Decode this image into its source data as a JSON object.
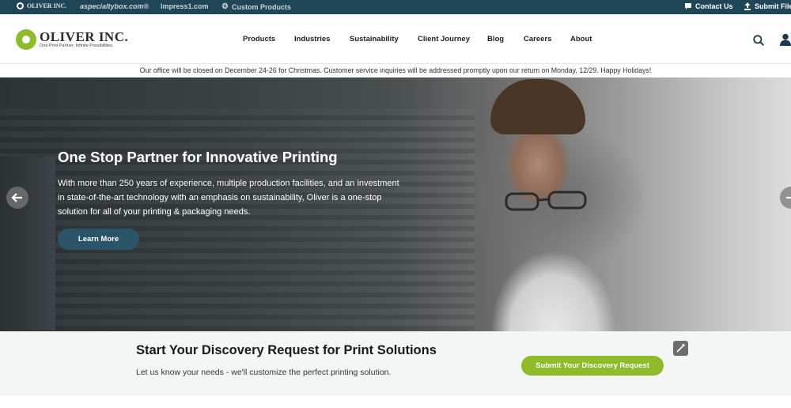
{
  "topbar": {
    "brands": [
      "OLIVER INC.",
      "aspecialtybox.com®",
      "Impress1.com",
      "Custom Products"
    ],
    "contact_label": "Contact Us",
    "submit_label": "Submit Files"
  },
  "header": {
    "logo_name": "OLIVER INC.",
    "logo_tagline": "One Print Partner, Infinite Possibilities.",
    "nav": [
      "Products",
      "Industries",
      "Sustainability",
      "Client Journey",
      "Blog",
      "Careers",
      "About"
    ]
  },
  "announcement": "Our office will be closed on December 24-26 for Christmas. Customer service inquiries will be addressed promptly upon our return on Monday, 12/29. Happy Holidays!",
  "hero": {
    "title": "One Stop Partner for Innovative Printing",
    "text": "With more than 250 years of experience, multiple production facilities, and an investment in state-of-the-art technology with an emphasis on sustainability, Oliver is a one-stop solution for all of your printing & packaging needs.",
    "button": "Learn More"
  },
  "discovery": {
    "title": "Start Your Discovery Request for Print Solutions",
    "text": "Let us know your needs - we'll customize the perfect printing solution.",
    "button": "Submit Your Discovery Request"
  },
  "colors": {
    "topbar": "#1f4657",
    "accent_green": "#8dbb2a",
    "button_blue": "#2a5468"
  }
}
